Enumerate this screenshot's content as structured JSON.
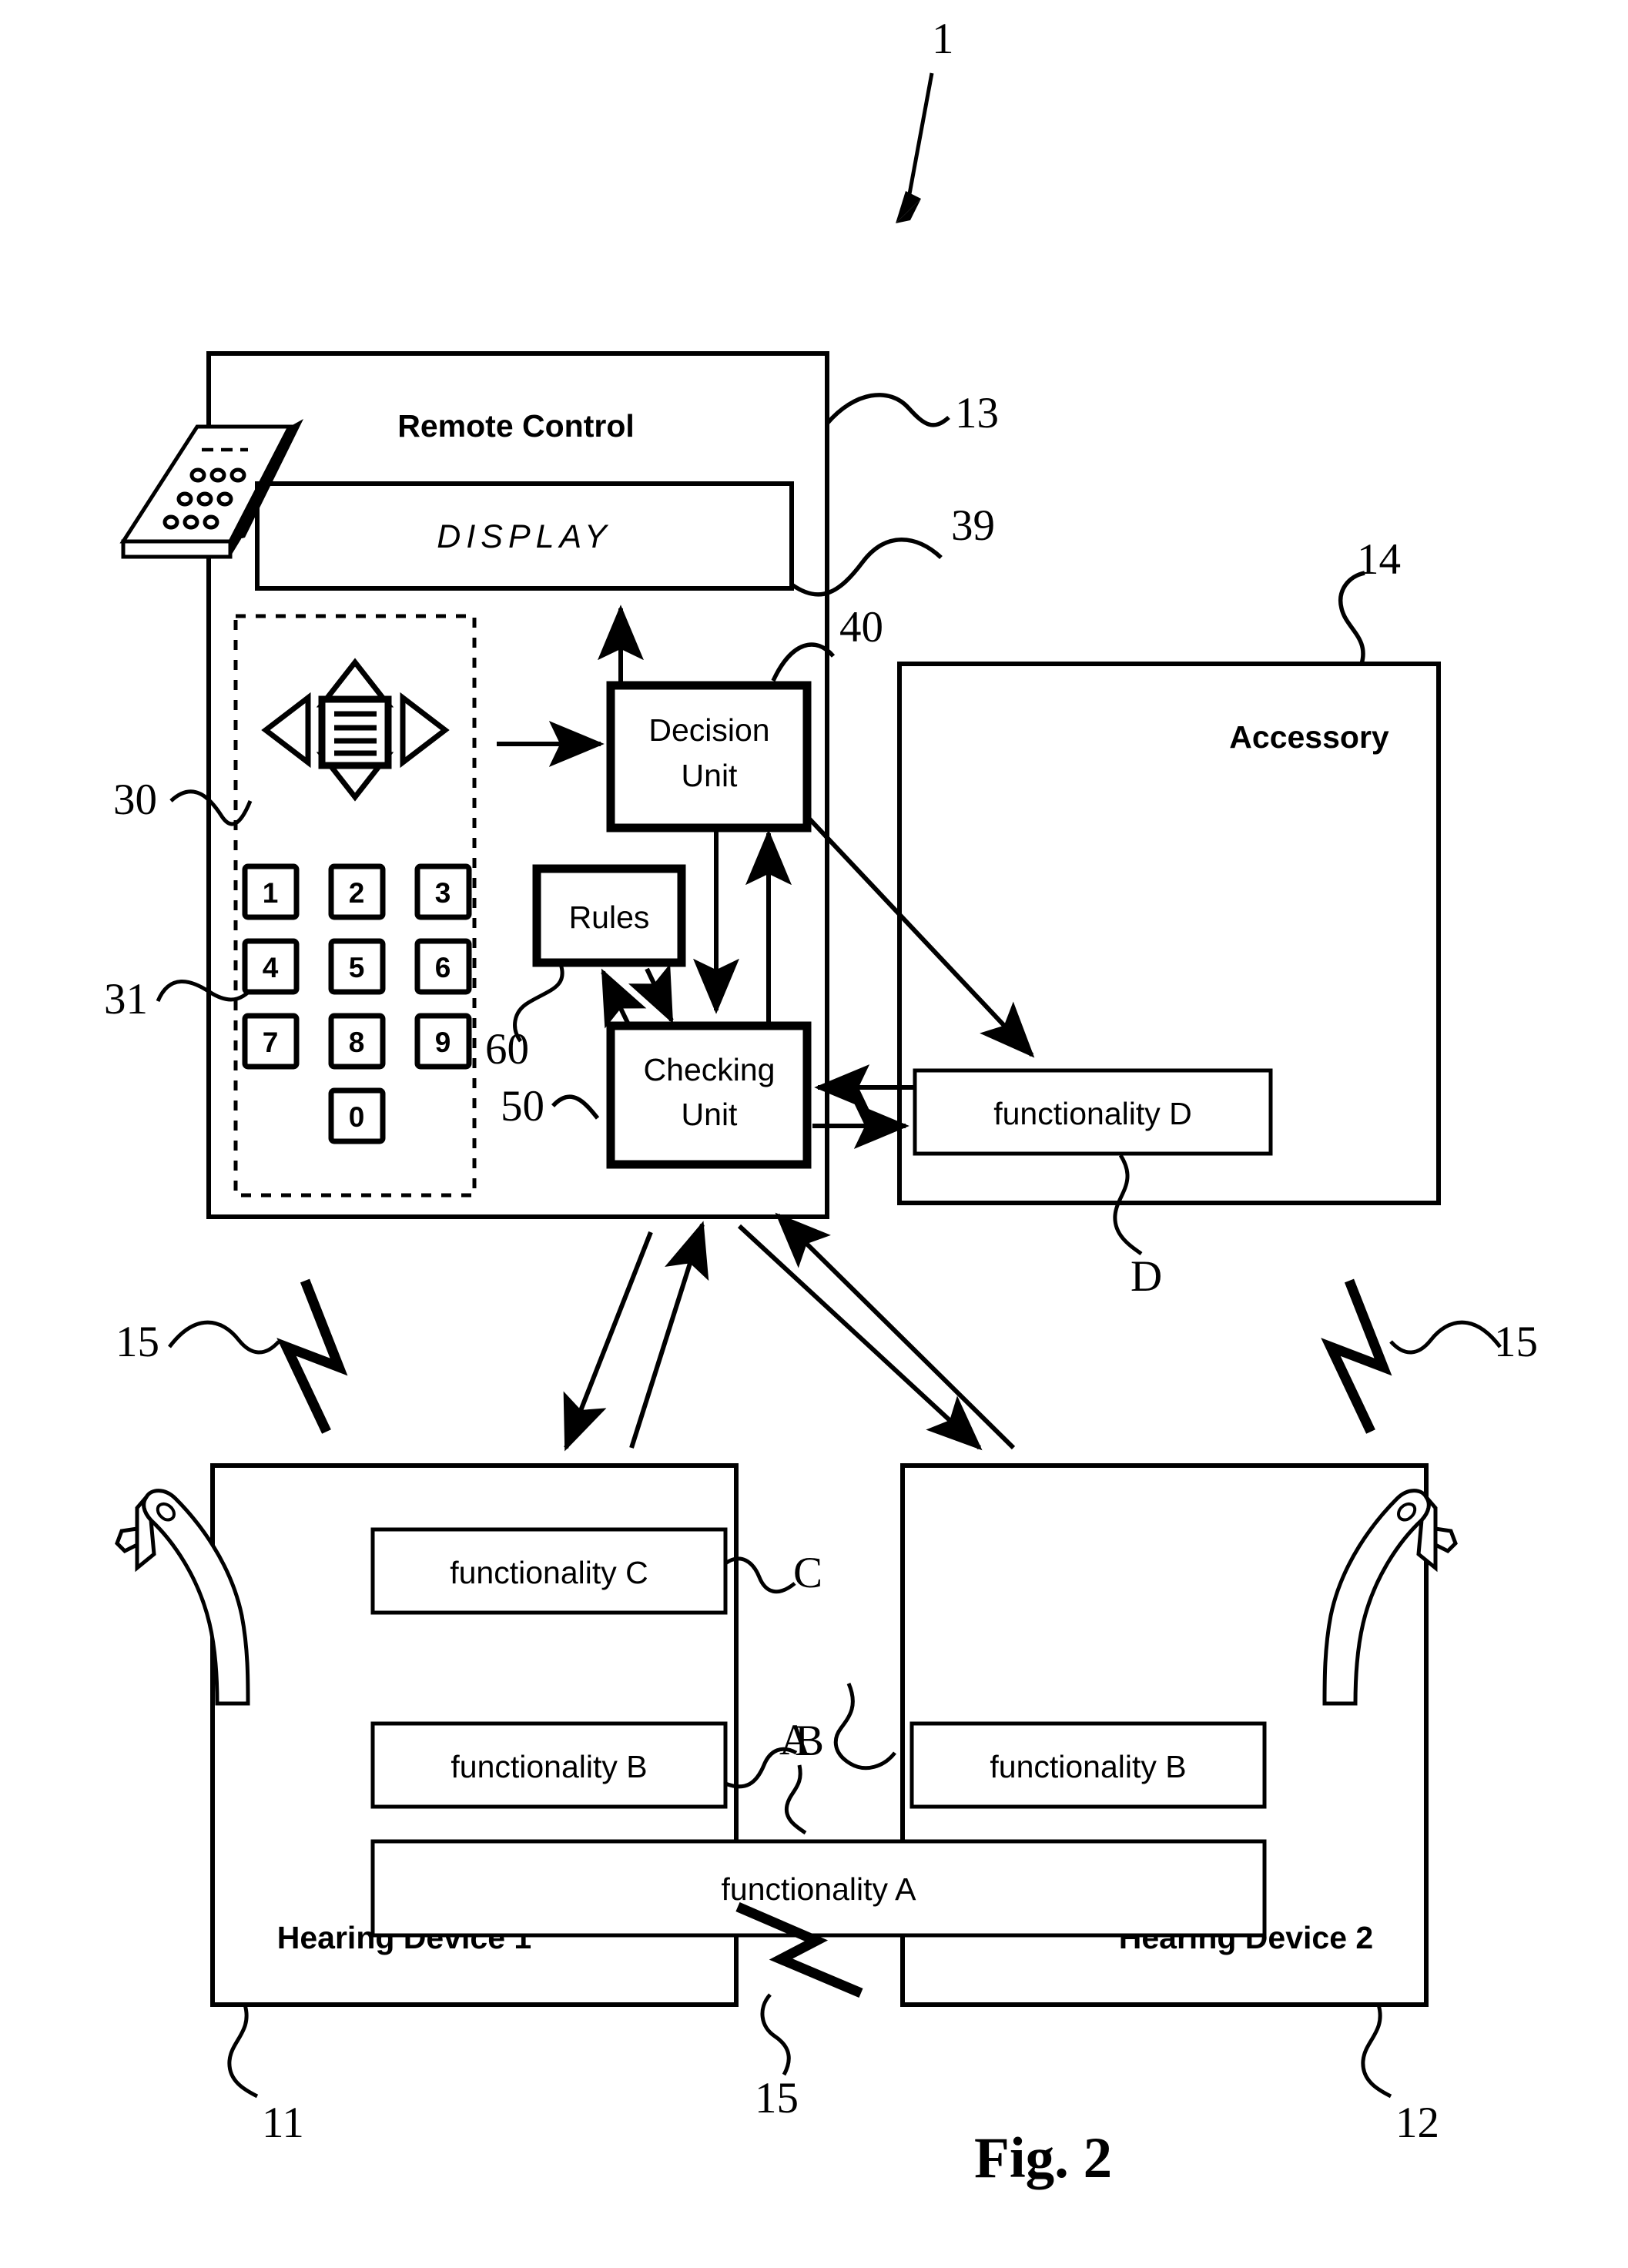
{
  "figure": {
    "caption": "Fig. 2",
    "system_ref": "1"
  },
  "remote_control": {
    "title": "Remote Control",
    "ref": "13",
    "display": {
      "label": "DISPLAY",
      "ref": "39"
    },
    "keypad_group_ref": "30",
    "keys_ref": "31",
    "keys": [
      "1",
      "2",
      "3",
      "4",
      "5",
      "6",
      "7",
      "8",
      "9",
      "0"
    ],
    "dpad": {
      "up": "up-arrow",
      "down": "down-arrow",
      "left": "left-arrow",
      "right": "right-arrow",
      "center": "menu-lines"
    },
    "decision_unit": {
      "line1": "Decision",
      "line2": "Unit",
      "ref": "40"
    },
    "rules": {
      "label": "Rules",
      "ref": "60"
    },
    "checking_unit": {
      "line1": "Checking",
      "line2": "Unit",
      "ref": "50"
    }
  },
  "accessory": {
    "title": "Accessory",
    "ref": "14",
    "functionality": {
      "label": "functionality D",
      "tag": "D"
    }
  },
  "hearing_device_1": {
    "title": "Hearing Device 1",
    "ref": "11",
    "functionalities": [
      {
        "label": "functionality C",
        "tag": "C"
      },
      {
        "label": "functionality B",
        "tag": "B"
      }
    ]
  },
  "hearing_device_2": {
    "title": "Hearing Device 2",
    "ref": "12",
    "functionalities": [
      {
        "label": "functionality B",
        "tag": ""
      }
    ]
  },
  "shared_functionality": {
    "label": "functionality A",
    "tag": "A"
  },
  "wireless_links": {
    "label": "15",
    "instances": [
      "15",
      "15",
      "15"
    ]
  },
  "colors": {
    "ink": "#000000",
    "paper": "#ffffff"
  }
}
